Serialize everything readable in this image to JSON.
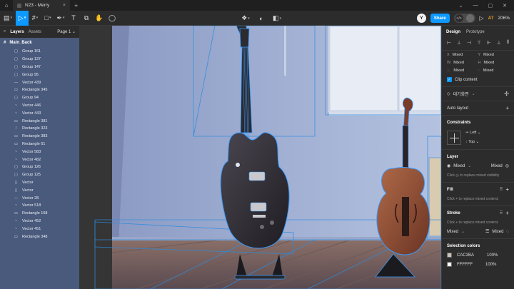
{
  "titlebar": {
    "file_name": "N23 - Merry"
  },
  "toolbar": {
    "share_label": "Share",
    "avatar_letter": "Y",
    "ai_label": "A7",
    "zoom": "206%"
  },
  "left_panel": {
    "tab_layers": "Layers",
    "tab_assets": "Assets",
    "page": "Page 1",
    "root_layer": "Main_Back",
    "layers": [
      {
        "icon": "▢",
        "name": "Group 161"
      },
      {
        "icon": "▢",
        "name": "Group 137"
      },
      {
        "icon": "▢",
        "name": "Group 147"
      },
      {
        "icon": "▢",
        "name": "Group 95"
      },
      {
        "icon": "—",
        "name": "Vector 439"
      },
      {
        "icon": "▭",
        "name": "Rectangle 345"
      },
      {
        "icon": "▢",
        "name": "Group 94"
      },
      {
        "icon": "~",
        "name": "Vector 446"
      },
      {
        "icon": "~",
        "name": "Vector 443"
      },
      {
        "icon": "▭",
        "name": "Rectangle 381"
      },
      {
        "icon": "/",
        "name": "Rectangle 323"
      },
      {
        "icon": "▭",
        "name": "Rectangle 383"
      },
      {
        "icon": "▭",
        "name": "Rectangle 61"
      },
      {
        "icon": "~",
        "name": "Vector 583"
      },
      {
        "icon": "~",
        "name": "Vector 482"
      },
      {
        "icon": "▢",
        "name": "Group 126"
      },
      {
        "icon": "▢",
        "name": "Group 125"
      },
      {
        "icon": "▯",
        "name": "Vector"
      },
      {
        "icon": "▯",
        "name": "Vector"
      },
      {
        "icon": "—",
        "name": "Vector 28"
      },
      {
        "icon": "~",
        "name": "Vector 518"
      },
      {
        "icon": "▭",
        "name": "Rectangle 168"
      },
      {
        "icon": "~",
        "name": "Vector 452"
      },
      {
        "icon": "~",
        "name": "Vector 451"
      },
      {
        "icon": "▭",
        "name": "Rectangle 348"
      }
    ]
  },
  "right_panel": {
    "tab_design": "Design",
    "tab_prototype": "Prototype",
    "x_label": "X",
    "x_value": "Mixed",
    "y_label": "Y",
    "y_value": "Mixed",
    "w_label": "W",
    "w_value": "Mixed",
    "h_label": "H",
    "h_value": "Mixed",
    "r_label": "∟",
    "r_value": "Mixed",
    "c_label": "◌",
    "c_value": "Mixed",
    "clip": "Clip content",
    "component": "대기화면",
    "auto_layout": "Auto layout",
    "constraints": "Constraints",
    "c_left": "Left",
    "c_top": "Top",
    "layer": "Layer",
    "layer_mode": "Mixed",
    "layer_opacity": "Mixed",
    "layer_hint": "Click ◎ to replace mixed visibility",
    "fill": "Fill",
    "fill_hint": "Click + to replace mixed content.",
    "stroke": "Stroke",
    "stroke_hint": "Click + to replace mixed content.",
    "stroke_pos": "Mixed",
    "stroke_weight": "Mixed",
    "selection_colors": "Selection colors",
    "colors": [
      {
        "hex": "CAC3BA",
        "opacity": "100%",
        "swatch": "#cac3ba"
      },
      {
        "hex": "FFFFFF",
        "opacity": "100%",
        "swatch": "#ffffff"
      }
    ]
  }
}
